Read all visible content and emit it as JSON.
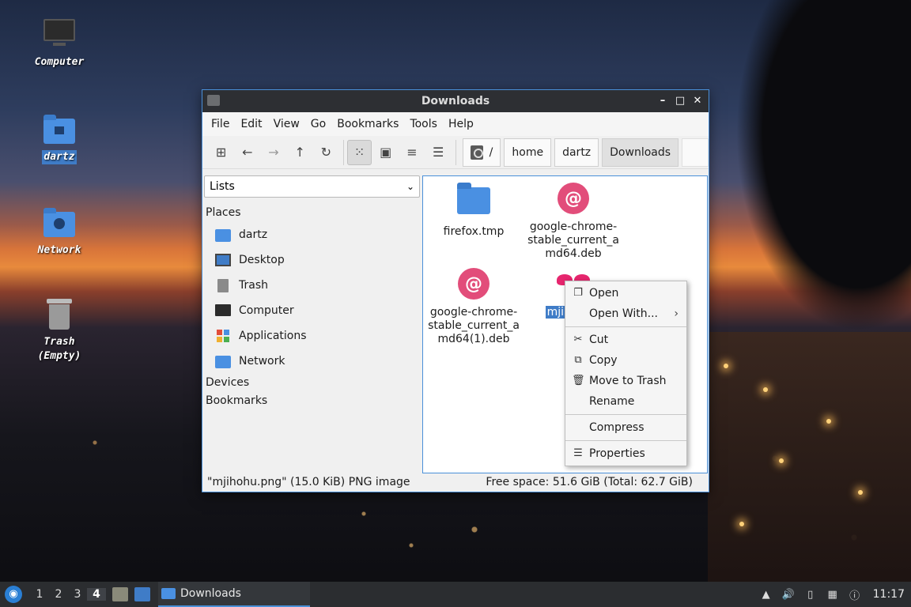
{
  "desktop": {
    "icons": [
      {
        "label": "Computer"
      },
      {
        "label": "dartz"
      },
      {
        "label": "Network"
      },
      {
        "label": "Trash\n(Empty)"
      }
    ]
  },
  "window": {
    "title": "Downloads",
    "controls": {
      "minimize": "–",
      "maximize": "□",
      "close": "✕"
    }
  },
  "menubar": {
    "items": [
      "File",
      "Edit",
      "View",
      "Go",
      "Bookmarks",
      "Tools",
      "Help"
    ]
  },
  "toolbar": {
    "breadcrumb": [
      "/",
      "home",
      "dartz",
      "Downloads"
    ]
  },
  "sidebar": {
    "mode_select": "Lists",
    "places_heading": "Places",
    "places": [
      "dartz",
      "Desktop",
      "Trash",
      "Computer",
      "Applications",
      "Network"
    ],
    "devices_heading": "Devices",
    "bookmarks_heading": "Bookmarks"
  },
  "files": [
    {
      "name": "firefox.tmp",
      "type": "folder"
    },
    {
      "name": "google-chrome-stable_current_amd64.deb",
      "type": "deb",
      "lines": [
        "google-chrome-",
        "stable_current_a",
        "md64.deb"
      ]
    },
    {
      "name": "google-chrome-stable_current_amd64(1).deb",
      "type": "deb",
      "lines": [
        "google-chrome-",
        "stable_current_a",
        "md64(1).deb"
      ]
    },
    {
      "name": "mjihohu.png",
      "type": "image",
      "label_visible": "mjiho"
    }
  ],
  "status": {
    "left": "\"mjihohu.png\" (15.0 KiB) PNG image",
    "right": "Free space: 51.6 GiB (Total: 62.7 GiB)"
  },
  "context_menu": {
    "open": "Open",
    "open_with": "Open With...",
    "cut": "Cut",
    "copy": "Copy",
    "move_to_trash": "Move to Trash",
    "rename": "Rename",
    "compress": "Compress",
    "properties": "Properties"
  },
  "taskbar": {
    "workspaces": [
      "1",
      "2",
      "3",
      "4"
    ],
    "active_workspace": "4",
    "task_label": "Downloads",
    "clock": "11:17"
  },
  "colors": {
    "accent": "#4a90d9",
    "selection": "#3f7cc7",
    "deb": "#e24d7a"
  }
}
